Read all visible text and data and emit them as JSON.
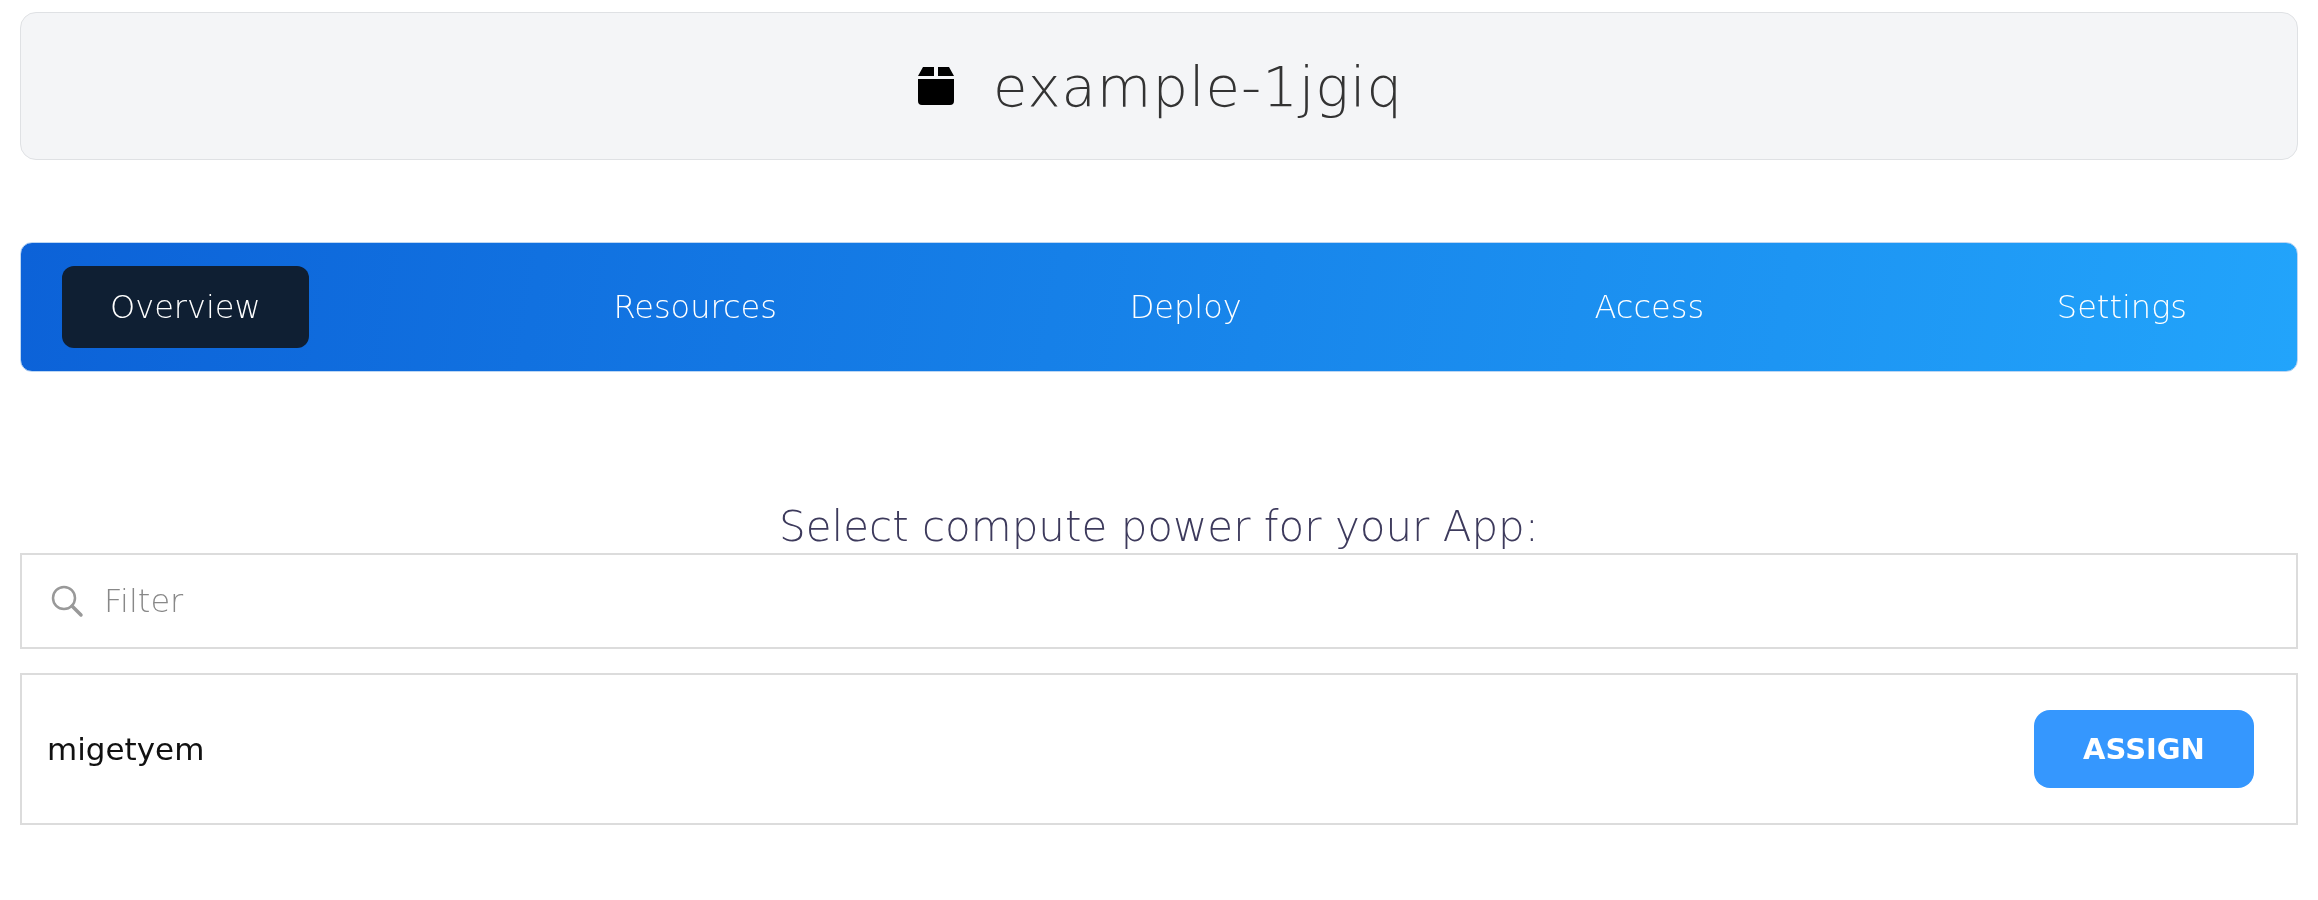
{
  "header": {
    "title": "example-1jgiq"
  },
  "tabs": [
    {
      "label": "Overview",
      "selected": true
    },
    {
      "label": "Resources",
      "selected": false
    },
    {
      "label": "Deploy",
      "selected": false
    },
    {
      "label": "Access",
      "selected": false
    },
    {
      "label": "Settings",
      "selected": false
    }
  ],
  "prompt": "Select compute power for your App:",
  "search": {
    "placeholder": "Filter"
  },
  "rows": [
    {
      "name": "migetyem",
      "button": "ASSIGN"
    }
  ]
}
